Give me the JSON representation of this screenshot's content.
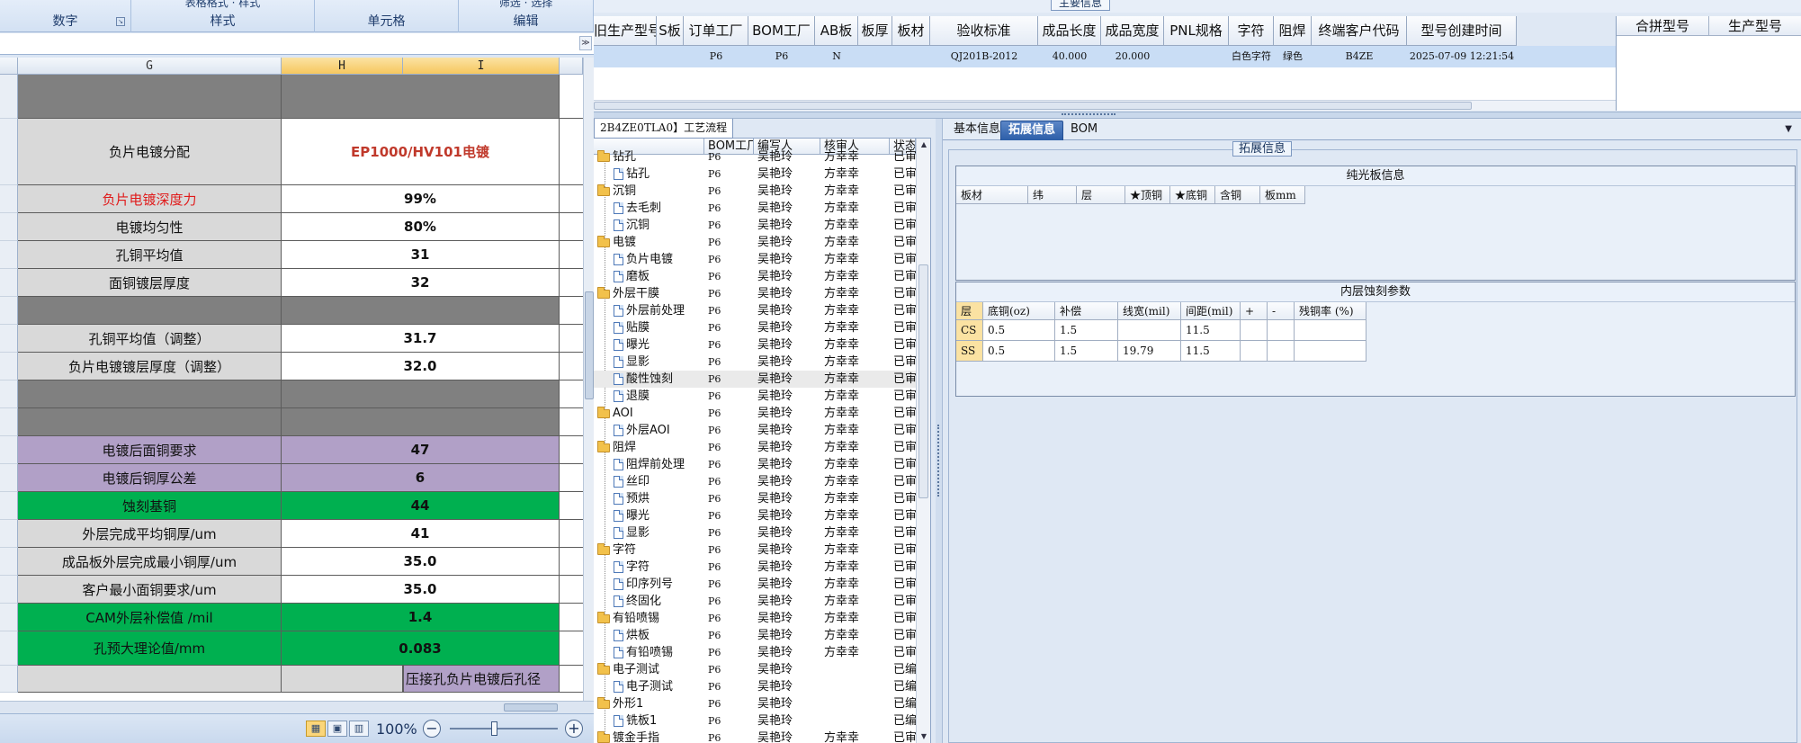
{
  "excel": {
    "ribbon": {
      "groups": [
        {
          "label": "数字",
          "top": ""
        },
        {
          "label": "样式",
          "top": "表格格式 · 样式"
        },
        {
          "label": "单元格",
          "top": ""
        },
        {
          "label": "编辑",
          "top": "筛选 · 选择"
        }
      ]
    },
    "columns": [
      "G",
      "H",
      "I"
    ],
    "rows": [
      {
        "label": "",
        "value": "",
        "style": "dark"
      },
      {
        "label": "负片电镀分配",
        "value": "EP1000/HV101电镀",
        "style": "plain",
        "valueColor": "#c0392b"
      },
      {
        "label": "负片电镀深度力",
        "value": "99%",
        "style": "plain",
        "labelColor": "#e01b1b"
      },
      {
        "label": "电镀均匀性",
        "value": "80%",
        "style": "plain"
      },
      {
        "label": "孔铜平均值",
        "value": "31",
        "style": "plain"
      },
      {
        "label": "面铜镀层厚度",
        "value": "32",
        "style": "plain"
      },
      {
        "label": "",
        "value": "",
        "style": "dark"
      },
      {
        "label": "孔铜平均值（调整）",
        "value": "31.7",
        "style": "plain"
      },
      {
        "label": "负片电镀镀层厚度（调整）",
        "value": "32.0",
        "style": "plain"
      },
      {
        "label": "",
        "value": "",
        "style": "dark"
      },
      {
        "label": "",
        "value": "",
        "style": "dark"
      },
      {
        "label": "电镀后面铜要求",
        "value": "47",
        "style": "purple"
      },
      {
        "label": "电镀后铜厚公差",
        "value": "6",
        "style": "purple"
      },
      {
        "label": "蚀刻基铜",
        "value": "44",
        "style": "green"
      },
      {
        "label": "外层完成平均铜厚/um",
        "value": "41",
        "style": "plain"
      },
      {
        "label": "成品板外层完成最小铜厚/um",
        "value": "35.0",
        "style": "plain"
      },
      {
        "label": "客户最小面铜要求/um",
        "value": "35.0",
        "style": "plain"
      },
      {
        "label": "CAM外层补偿值 /mil",
        "value": "1.4",
        "style": "green"
      },
      {
        "label": "孔预大理论值/mm",
        "value": "0.083",
        "style": "green"
      },
      {
        "label": "",
        "value": "",
        "style": "partial",
        "tail": "压接孔负片电镀后孔径"
      }
    ],
    "status": {
      "zoom": "100%",
      "zoom_out": "−",
      "zoom_in": "+"
    },
    "scroll_icons": {
      "expand": "≫",
      "first": "⏮",
      "prev": "◀",
      "next": "▶",
      "last": "⏭"
    }
  },
  "erp": {
    "main_group_title": "主要信息",
    "top_headers": [
      "旧生产型号",
      "S板",
      "订单工厂",
      "BOM工厂",
      "AB板",
      "板厚",
      "板材",
      "验收标准",
      "成品长度",
      "成品宽度",
      "PNL规格",
      "字符",
      "阻焊",
      "终端客户代码",
      "型号创建时间"
    ],
    "top_row": [
      "",
      "",
      "P6",
      "P6",
      "N",
      "",
      "",
      "QJ201B-2012",
      "40.000",
      "20.000",
      "",
      "白色字符",
      "绿色",
      "B4ZE",
      "2025-07-09 12:21:54"
    ],
    "right_headers": [
      "合拼型号",
      "生产型号"
    ],
    "tree": {
      "tab_label": "2B4ZE0TLA0】工艺流程",
      "headers": [
        "",
        "BOM工厂",
        "编写人",
        "核审人",
        "状态"
      ],
      "rows": [
        {
          "name": "钻孔",
          "type": "folder",
          "bom": "P6",
          "writer": "吴艳玲",
          "reviewer": "方幸幸",
          "status": "已审"
        },
        {
          "name": "钻孔",
          "type": "doc",
          "bom": "P6",
          "writer": "吴艳玲",
          "reviewer": "方幸幸",
          "status": "已审"
        },
        {
          "name": "沉铜",
          "type": "folder",
          "bom": "P6",
          "writer": "吴艳玲",
          "reviewer": "方幸幸",
          "status": "已审"
        },
        {
          "name": "去毛刺",
          "type": "doc",
          "bom": "P6",
          "writer": "吴艳玲",
          "reviewer": "方幸幸",
          "status": "已审"
        },
        {
          "name": "沉铜",
          "type": "doc",
          "bom": "P6",
          "writer": "吴艳玲",
          "reviewer": "方幸幸",
          "status": "已审"
        },
        {
          "name": "电镀",
          "type": "folder",
          "bom": "P6",
          "writer": "吴艳玲",
          "reviewer": "方幸幸",
          "status": "已审"
        },
        {
          "name": "负片电镀",
          "type": "doc",
          "bom": "P6",
          "writer": "吴艳玲",
          "reviewer": "方幸幸",
          "status": "已审"
        },
        {
          "name": "磨板",
          "type": "doc",
          "bom": "P6",
          "writer": "吴艳玲",
          "reviewer": "方幸幸",
          "status": "已审"
        },
        {
          "name": "外层干膜",
          "type": "folder",
          "bom": "P6",
          "writer": "吴艳玲",
          "reviewer": "方幸幸",
          "status": "已审"
        },
        {
          "name": "外层前处理",
          "type": "doc",
          "bom": "P6",
          "writer": "吴艳玲",
          "reviewer": "方幸幸",
          "status": "已审"
        },
        {
          "name": "贴膜",
          "type": "doc",
          "bom": "P6",
          "writer": "吴艳玲",
          "reviewer": "方幸幸",
          "status": "已审"
        },
        {
          "name": "曝光",
          "type": "doc",
          "bom": "P6",
          "writer": "吴艳玲",
          "reviewer": "方幸幸",
          "status": "已审"
        },
        {
          "name": "显影",
          "type": "doc",
          "bom": "P6",
          "writer": "吴艳玲",
          "reviewer": "方幸幸",
          "status": "已审"
        },
        {
          "name": "酸性蚀刻",
          "type": "doc",
          "bom": "P6",
          "writer": "吴艳玲",
          "reviewer": "方幸幸",
          "status": "已审",
          "highlight": true
        },
        {
          "name": "退膜",
          "type": "doc",
          "bom": "P6",
          "writer": "吴艳玲",
          "reviewer": "方幸幸",
          "status": "已审"
        },
        {
          "name": "AOI",
          "type": "folder",
          "bom": "P6",
          "writer": "吴艳玲",
          "reviewer": "方幸幸",
          "status": "已审"
        },
        {
          "name": "外层AOI",
          "type": "doc",
          "bom": "P6",
          "writer": "吴艳玲",
          "reviewer": "方幸幸",
          "status": "已审"
        },
        {
          "name": "阻焊",
          "type": "folder",
          "bom": "P6",
          "writer": "吴艳玲",
          "reviewer": "方幸幸",
          "status": "已审"
        },
        {
          "name": "阻焊前处理",
          "type": "doc",
          "bom": "P6",
          "writer": "吴艳玲",
          "reviewer": "方幸幸",
          "status": "已审"
        },
        {
          "name": "丝印",
          "type": "doc",
          "bom": "P6",
          "writer": "吴艳玲",
          "reviewer": "方幸幸",
          "status": "已审"
        },
        {
          "name": "预烘",
          "type": "doc",
          "bom": "P6",
          "writer": "吴艳玲",
          "reviewer": "方幸幸",
          "status": "已审"
        },
        {
          "name": "曝光",
          "type": "doc",
          "bom": "P6",
          "writer": "吴艳玲",
          "reviewer": "方幸幸",
          "status": "已审"
        },
        {
          "name": "显影",
          "type": "doc",
          "bom": "P6",
          "writer": "吴艳玲",
          "reviewer": "方幸幸",
          "status": "已审"
        },
        {
          "name": "字符",
          "type": "folder",
          "bom": "P6",
          "writer": "吴艳玲",
          "reviewer": "方幸幸",
          "status": "已审"
        },
        {
          "name": "字符",
          "type": "doc",
          "bom": "P6",
          "writer": "吴艳玲",
          "reviewer": "方幸幸",
          "status": "已审"
        },
        {
          "name": "印序列号",
          "type": "doc",
          "bom": "P6",
          "writer": "吴艳玲",
          "reviewer": "方幸幸",
          "status": "已审"
        },
        {
          "name": "终固化",
          "type": "doc",
          "bom": "P6",
          "writer": "吴艳玲",
          "reviewer": "方幸幸",
          "status": "已审"
        },
        {
          "name": "有铅喷锡",
          "type": "folder",
          "bom": "P6",
          "writer": "吴艳玲",
          "reviewer": "方幸幸",
          "status": "已审"
        },
        {
          "name": "烘板",
          "type": "doc",
          "bom": "P6",
          "writer": "吴艳玲",
          "reviewer": "方幸幸",
          "status": "已审"
        },
        {
          "name": "有铅喷锡",
          "type": "doc",
          "bom": "P6",
          "writer": "吴艳玲",
          "reviewer": "方幸幸",
          "status": "已审"
        },
        {
          "name": "电子测试",
          "type": "folder",
          "bom": "P6",
          "writer": "吴艳玲",
          "reviewer": "",
          "status": "已编"
        },
        {
          "name": "电子测试",
          "type": "doc",
          "bom": "P6",
          "writer": "吴艳玲",
          "reviewer": "",
          "status": "已编"
        },
        {
          "name": "外形1",
          "type": "folder",
          "bom": "P6",
          "writer": "吴艳玲",
          "reviewer": "",
          "status": "已编"
        },
        {
          "name": "铣板1",
          "type": "doc",
          "bom": "P6",
          "writer": "吴艳玲",
          "reviewer": "",
          "status": "已编"
        },
        {
          "name": "镀金手指",
          "type": "folder",
          "bom": "P6",
          "writer": "吴艳玲",
          "reviewer": "方幸幸",
          "status": "已审"
        }
      ],
      "scroll_up": "▲",
      "scroll_down": "▼"
    },
    "detail": {
      "tabs": [
        "基本信息",
        "拓展信息",
        "BOM"
      ],
      "active_tab": "拓展信息",
      "legend": "拓展信息",
      "dropdown_icon": "▼",
      "bare_board": {
        "title": "纯光板信息",
        "headers": [
          "板材",
          "纬",
          "层",
          "★顶铜",
          "★底铜",
          "含铜",
          "板mm"
        ]
      },
      "inner_etch": {
        "title": "内层蚀刻参数",
        "headers": [
          "层",
          "底铜(oz)",
          "补偿",
          "线宽(mil)",
          "间距(mil)",
          "+",
          "-",
          "残铜率 (%)"
        ],
        "rows": [
          [
            "CS",
            "0.5",
            "1.5",
            "",
            "11.5",
            "",
            "",
            ""
          ],
          [
            "SS",
            "0.5",
            "1.5",
            "19.79",
            "11.5",
            "",
            "",
            ""
          ]
        ]
      }
    }
  }
}
